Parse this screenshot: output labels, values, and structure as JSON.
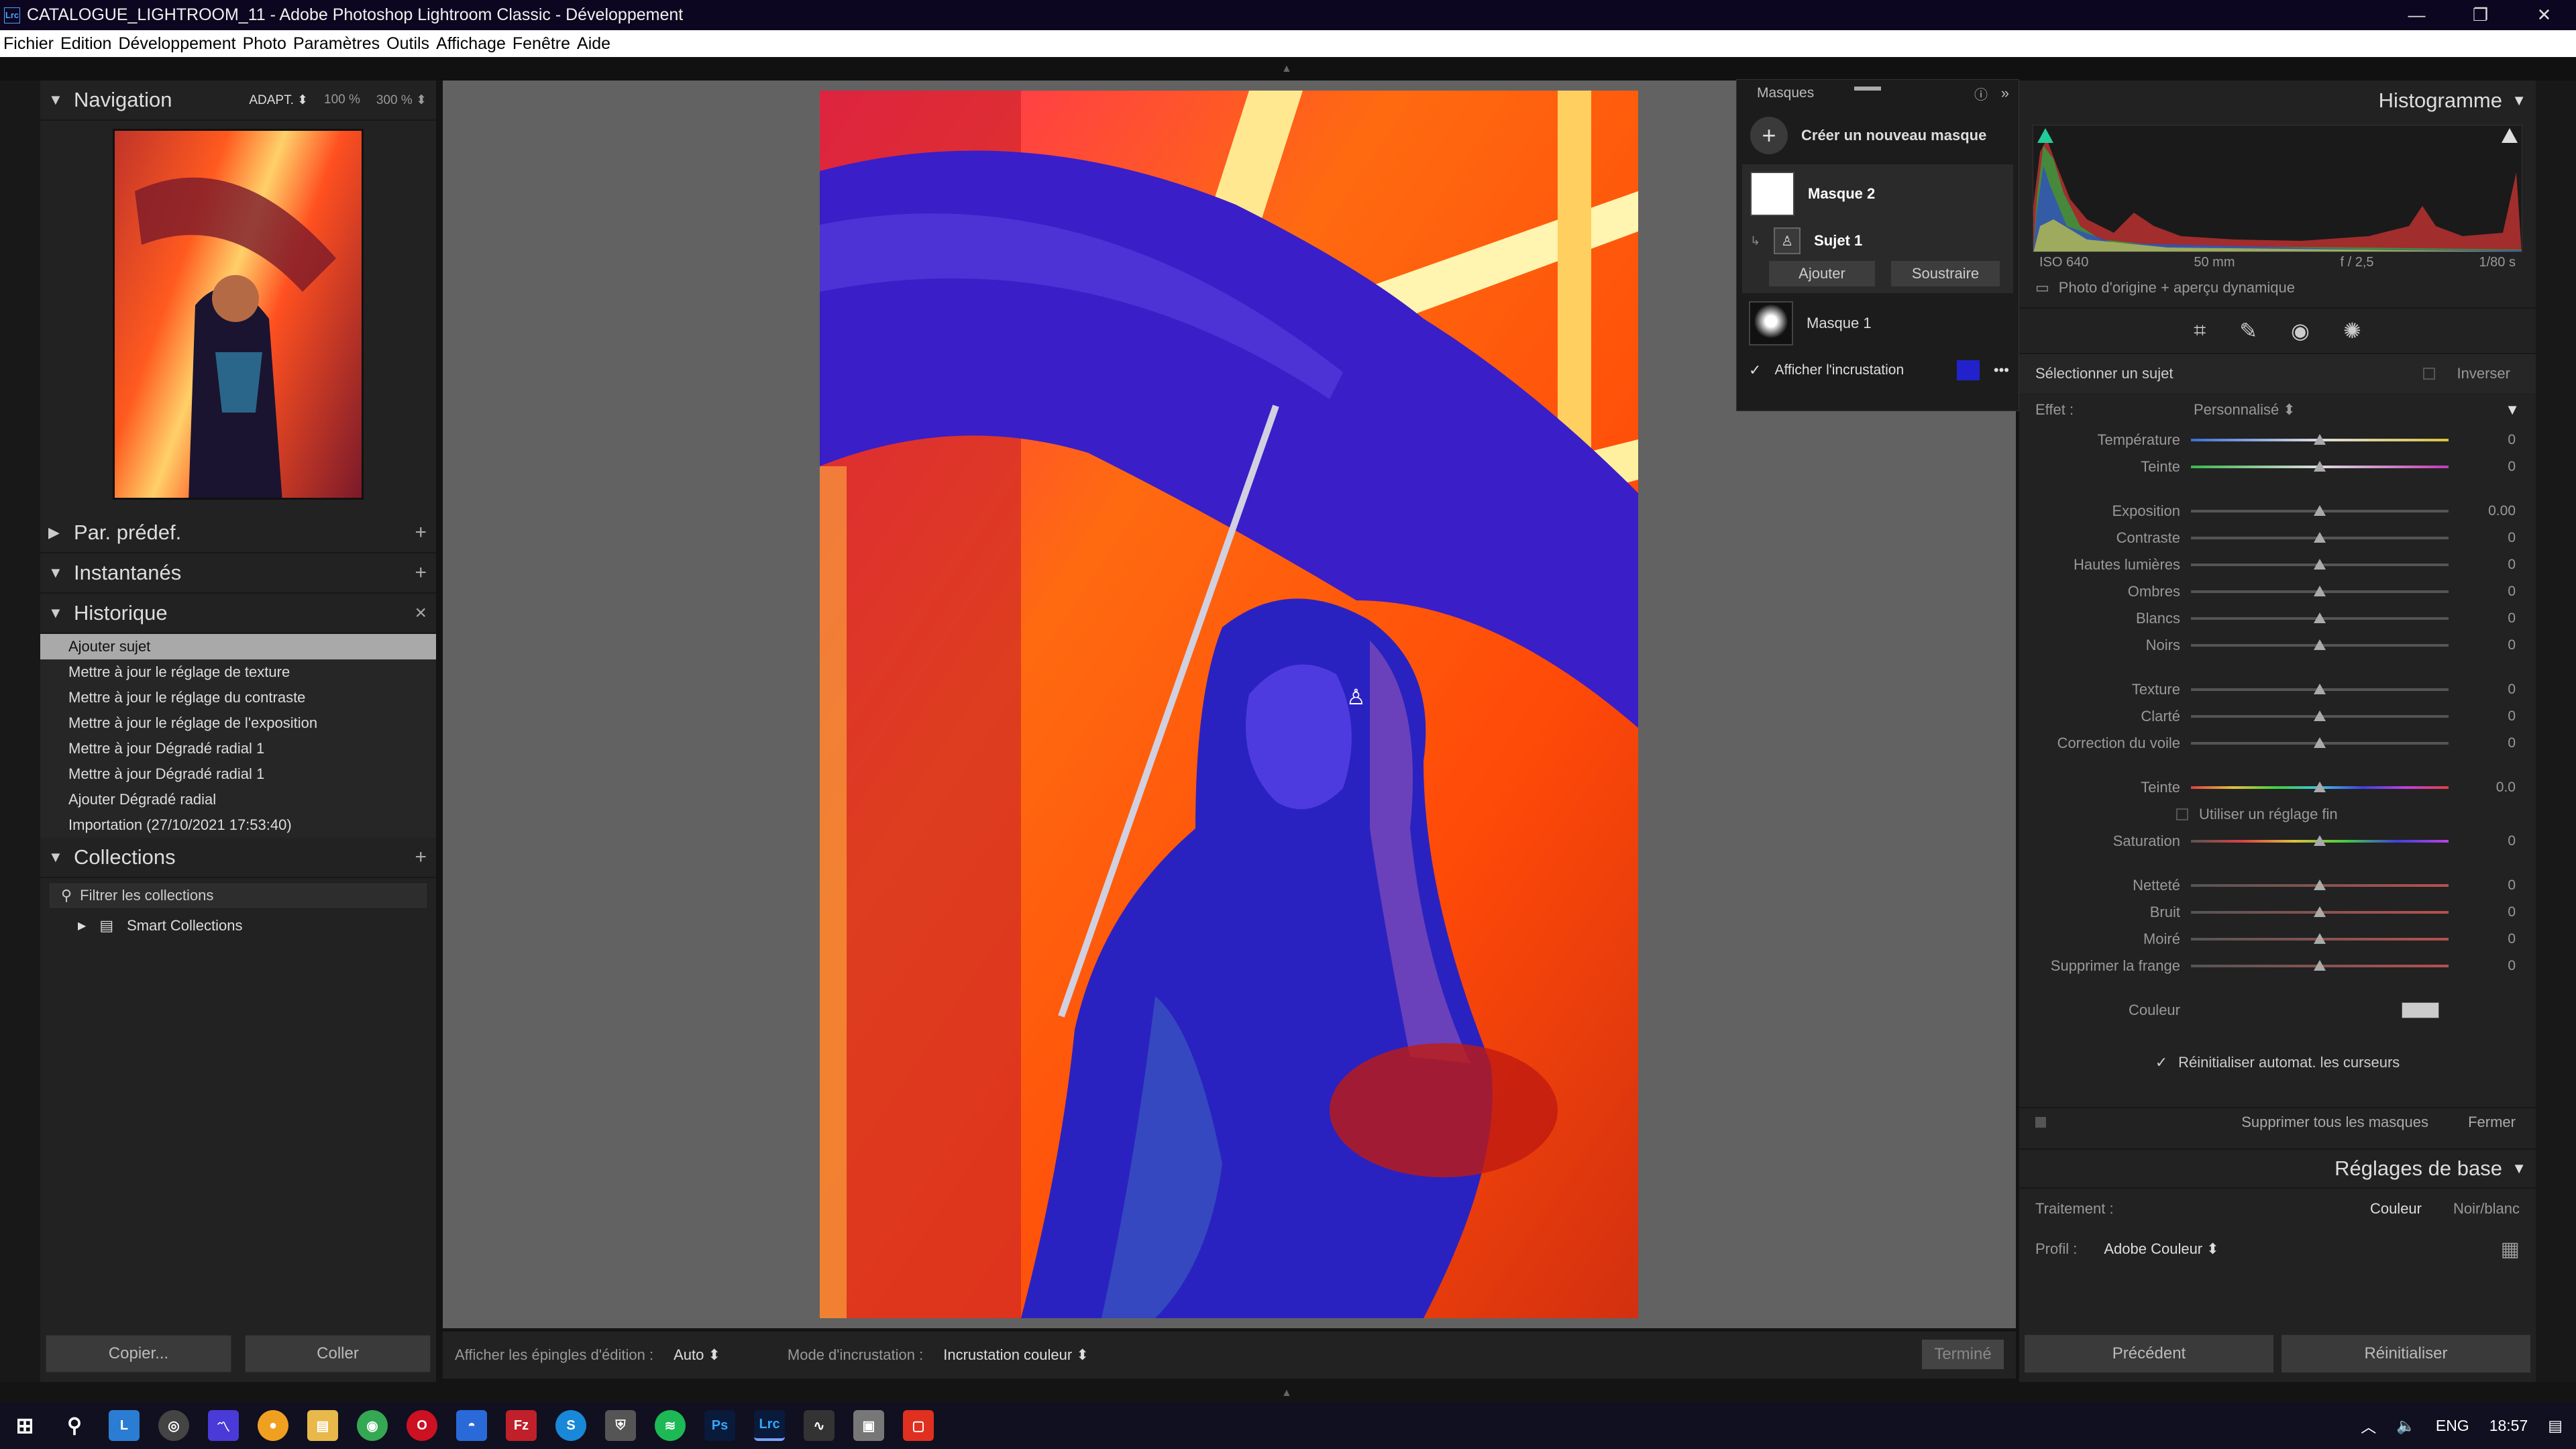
{
  "window": {
    "title": "CATALOGUE_LIGHTROOM_11 - Adobe Photoshop Lightroom Classic - Développement",
    "app_icon": "Lrc",
    "minimize": "—",
    "restore": "❐",
    "close": "✕"
  },
  "menu": [
    "Fichier",
    "Edition",
    "Développement",
    "Photo",
    "Paramètres",
    "Outils",
    "Affichage",
    "Fenêtre",
    "Aide"
  ],
  "left": {
    "navigation": {
      "title": "Navigation",
      "opts": [
        "ADAPT. ⬍",
        "100 %",
        "300 % ⬍"
      ]
    },
    "presets": {
      "title": "Par. prédef."
    },
    "snapshots": {
      "title": "Instantanés"
    },
    "history": {
      "title": "Historique",
      "items": [
        "Ajouter sujet",
        "Mettre à jour le réglage de texture",
        "Mettre à jour le réglage du contraste",
        "Mettre à jour le réglage de l'exposition",
        "Mettre à jour Dégradé radial 1",
        "Mettre à jour Dégradé radial 1",
        "Ajouter Dégradé radial",
        "Importation (27/10/2021 17:53:40)"
      ]
    },
    "collections": {
      "title": "Collections",
      "filter": "Filtrer les collections",
      "smart": "Smart Collections"
    },
    "copy": "Copier...",
    "paste": "Coller"
  },
  "toolbar": {
    "pins_label": "Afficher les épingles d'édition :",
    "pins_value": "Auto ⬍",
    "overlay_label": "Mode d'incrustation :",
    "overlay_value": "Incrustation couleur ⬍",
    "done": "Terminé"
  },
  "masks": {
    "title": "Masques",
    "create": "Créer un nouveau masque",
    "mask2": "Masque 2",
    "subject": "Sujet 1",
    "add": "Ajouter",
    "subtract": "Soustraire",
    "mask1": "Masque 1",
    "show_overlay": "Afficher l'incrustation",
    "overlay_color": "#2222cc"
  },
  "right": {
    "histogram": {
      "title": "Histogramme",
      "iso": "ISO 640",
      "focal": "50 mm",
      "aperture": "f / 2,5",
      "shutter": "1/80 s",
      "preview": "Photo d'origine + aperçu dynamique"
    },
    "select_subject": "Sélectionner un sujet",
    "invert": "Inverser",
    "effect_label": "Effet :",
    "effect_value": "Personnalisé ⬍",
    "sliders": [
      {
        "label": "Température",
        "value": "0",
        "pos": 0.5,
        "grad": "linear-gradient(90deg,#3a6fd8,#ddd,#d8c23a)"
      },
      {
        "label": "Teinte",
        "value": "0",
        "pos": 0.5,
        "grad": "linear-gradient(90deg,#3ab84a,#ddd,#c23ab8)"
      }
    ],
    "sliders2": [
      {
        "label": "Exposition",
        "value": "0.00",
        "pos": 0.5
      },
      {
        "label": "Contraste",
        "value": "0",
        "pos": 0.5
      },
      {
        "label": "Hautes lumières",
        "value": "0",
        "pos": 0.5
      },
      {
        "label": "Ombres",
        "value": "0",
        "pos": 0.5
      },
      {
        "label": "Blancs",
        "value": "0",
        "pos": 0.5
      },
      {
        "label": "Noirs",
        "value": "0",
        "pos": 0.5
      }
    ],
    "sliders3": [
      {
        "label": "Texture",
        "value": "0",
        "pos": 0.5
      },
      {
        "label": "Clarté",
        "value": "0",
        "pos": 0.5
      },
      {
        "label": "Correction du voile",
        "value": "0",
        "pos": 0.5
      }
    ],
    "hue": {
      "label": "Teinte",
      "value": "0.0",
      "pos": 0.5
    },
    "fine": "Utiliser un réglage fin",
    "saturation": {
      "label": "Saturation",
      "value": "0",
      "pos": 0.5
    },
    "sliders4": [
      {
        "label": "Netteté",
        "value": "0",
        "pos": 0.5
      },
      {
        "label": "Bruit",
        "value": "0",
        "pos": 0.5
      },
      {
        "label": "Moiré",
        "value": "0",
        "pos": 0.5
      },
      {
        "label": "Supprimer la frange",
        "value": "0",
        "pos": 0.5
      }
    ],
    "color_label": "Couleur",
    "auto_reset": "Réinitialiser automat. les curseurs",
    "delete_all": "Supprimer tous les masques",
    "close": "Fermer",
    "basic_title": "Réglages de base",
    "treatment_label": "Traitement :",
    "treatment_color": "Couleur",
    "treatment_bw": "Noir/blanc",
    "profile_label": "Profil :",
    "profile_value": "Adobe Couleur ⬍",
    "previous": "Précédent",
    "reset": "Réinitialiser"
  },
  "taskbar": {
    "lang": "ENG",
    "time": "18:57"
  }
}
